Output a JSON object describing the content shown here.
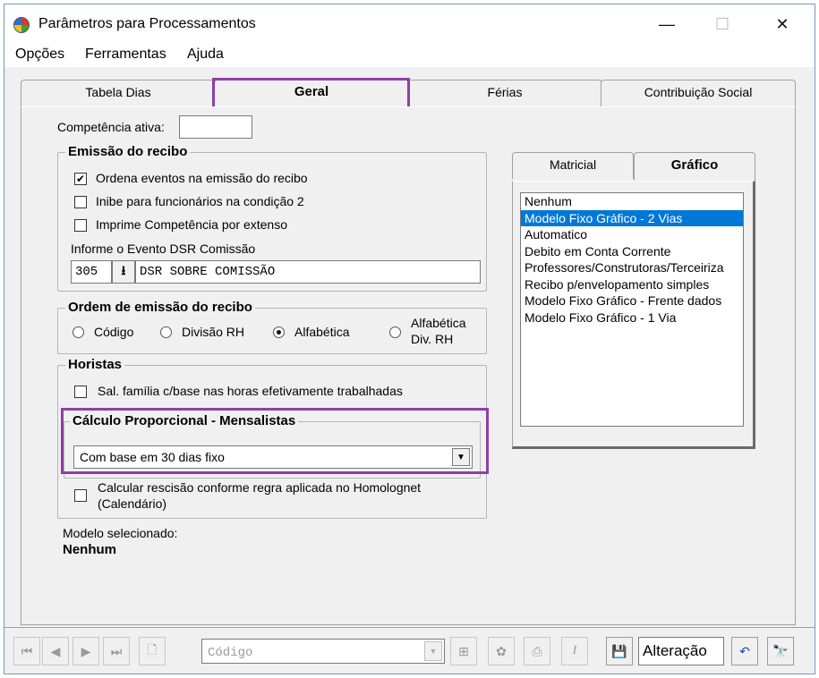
{
  "window": {
    "title": "Parâmetros para Processamentos",
    "minimize_glyph": "—",
    "maximize_glyph": "☐",
    "close_glyph": "✕"
  },
  "menu": [
    "Opções",
    "Ferramentas",
    "Ajuda"
  ],
  "tabs": [
    {
      "label": "Tabela Dias",
      "active": false
    },
    {
      "label": "Geral",
      "active": true
    },
    {
      "label": "Férias",
      "active": false
    },
    {
      "label": "Contribuição Social",
      "active": false
    }
  ],
  "competencia": {
    "label": "Competência ativa:",
    "value": ""
  },
  "emissao": {
    "title": "Emissão do recibo",
    "options": [
      {
        "label": "Ordena eventos na emissão do recibo",
        "checked": true
      },
      {
        "label": "Inibe para funcionários na condição 2",
        "checked": false
      },
      {
        "label": "Imprime Competência por extenso",
        "checked": false
      }
    ],
    "dsr_label": "Informe o Evento DSR Comissão",
    "dsr_code": "305",
    "dsr_desc": "DSR SOBRE COMISSÃO"
  },
  "ordem": {
    "title": "Ordem de emissão do recibo",
    "options": [
      {
        "label": "Código",
        "checked": false
      },
      {
        "label": "Divisão RH",
        "checked": false
      },
      {
        "label": "Alfabética",
        "checked": true
      },
      {
        "label_line1": "Alfabética",
        "label_line2": "Div.  RH",
        "checked": false
      }
    ]
  },
  "horistas": {
    "title": "Horistas",
    "option": "Sal. família c/base nas horas efetivamente trabalhadas"
  },
  "calculo": {
    "title": "Cálculo Proporcional - Mensalistas",
    "selected": "Com base em 30 dias fixo",
    "rescisao_line1": "Calcular rescisão conforme regra aplicada no Homolognet",
    "rescisao_line2": "(Calendário)"
  },
  "modelo": {
    "label": "Modelo selecionado:",
    "value": "Nenhum"
  },
  "subtabs": [
    {
      "label": "Matricial",
      "active": false
    },
    {
      "label": "Gráfico",
      "active": true
    }
  ],
  "modelos_list": [
    {
      "label": "Nenhum",
      "selected": false
    },
    {
      "label": "Modelo Fixo Gráfico - 2 Vias",
      "selected": true
    },
    {
      "label": "Automatico",
      "selected": false
    },
    {
      "label": "Debito em Conta Corrente",
      "selected": false
    },
    {
      "label": "Professores/Construtoras/Terceiriza",
      "selected": false
    },
    {
      "label": "Recibo p/envelopamento simples",
      "selected": false
    },
    {
      "label": "Modelo Fixo Gráfico - Frente dados",
      "selected": false
    },
    {
      "label": "Modelo Fixo Gráfico - 1 Via",
      "selected": false
    }
  ],
  "toolbar": {
    "search_placeholder": "Código",
    "mode": "Alteração"
  },
  "colors": {
    "highlight": "#8f3fa8",
    "selection": "#0078d7"
  }
}
